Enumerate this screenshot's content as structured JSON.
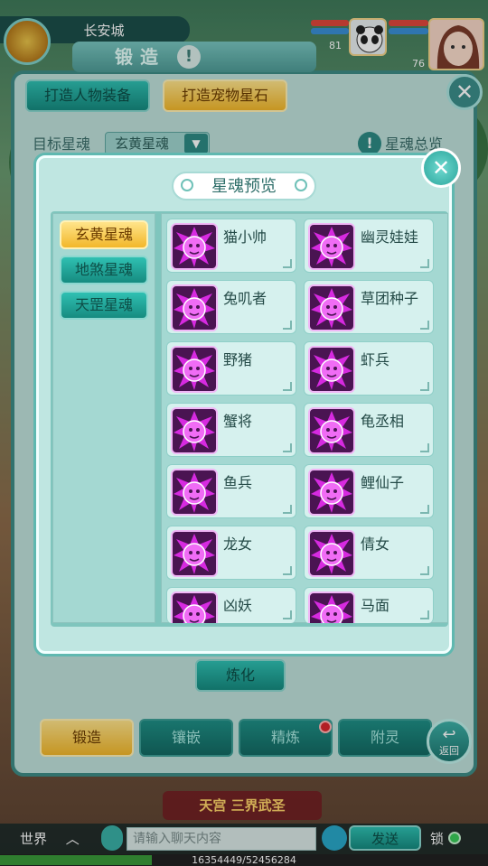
{
  "header": {
    "city": "长安城",
    "pet_level": "81",
    "player_level": "76",
    "colors": {
      "hp": "#e0473b",
      "mp": "#3a8fd6"
    }
  },
  "forge": {
    "title": "锻造",
    "tab_equipment": "打造人物装备",
    "tab_pet_star": "打造宠物星石",
    "target_label": "目标星魂",
    "target_value": "玄黄星魂",
    "overview_label": "星魂总览",
    "refine": "炼化",
    "bottom_tabs": [
      "锻造",
      "镶嵌",
      "精炼",
      "附灵"
    ],
    "back": "返回"
  },
  "dialog": {
    "title": "星魂预览",
    "categories": [
      {
        "label": "玄黄星魂",
        "selected": true
      },
      {
        "label": "地煞星魂",
        "selected": false
      },
      {
        "label": "天罡星魂",
        "selected": false
      }
    ],
    "souls": [
      "猫小帅",
      "幽灵娃娃",
      "兔叽者",
      "草团种子",
      "野猪",
      "虾兵",
      "蟹将",
      "龟丞相",
      "鱼兵",
      "鲤仙子",
      "龙女",
      "倩女",
      "凶妖",
      "马面"
    ]
  },
  "banner": "天宫 三界武圣",
  "chat": {
    "channel": "世界",
    "placeholder": "请输入聊天内容",
    "send": "发送",
    "lock": "锁",
    "exp": "16354449/52456284",
    "exp_fraction": 0.312
  },
  "colors": {
    "accent_teal": "#2fc0b2",
    "accent_gold": "#f2b72a",
    "icon_purple": "#b823c8"
  }
}
